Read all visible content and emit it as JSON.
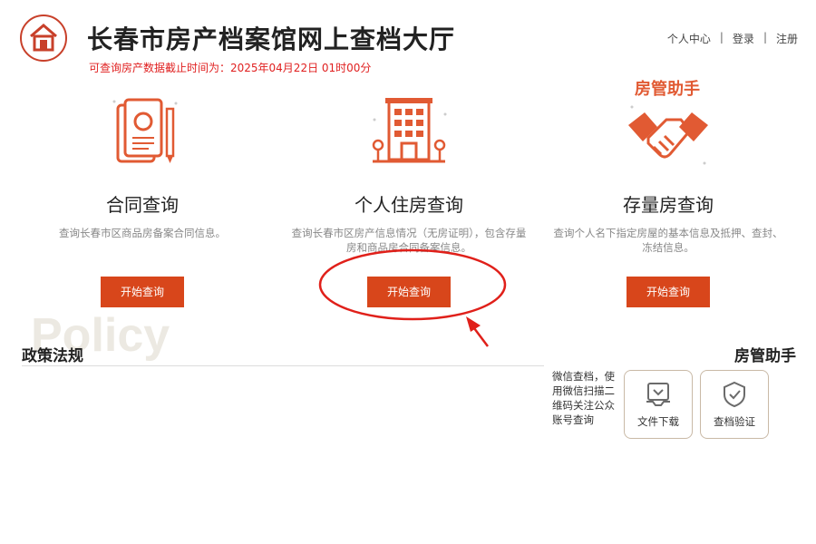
{
  "header": {
    "site_title": "长春市房产档案馆网上查档大厅",
    "notice": "可查询房产数据截止时间为：2025年04月22日 01时00分",
    "nav": {
      "personal_center": "个人中心",
      "login": "登录",
      "register": "注册",
      "separator": "|"
    }
  },
  "services": [
    {
      "title": "合同查询",
      "desc": "查询长春市区商品房备案合同信息。",
      "button": "开始查询",
      "icon": "contract-document-icon"
    },
    {
      "title": "个人住房查询",
      "desc": "查询长春市区房产信息情况（无房证明），包含存量房和商品房合同备案信息。",
      "button": "开始查询",
      "icon": "building-icon"
    },
    {
      "title": "存量房查询",
      "desc": "查询个人名下指定房屋的基本信息及抵押、查封、冻结信息。",
      "button": "开始查询",
      "icon": "handshake-icon",
      "tag": "房管助手"
    }
  ],
  "policy": {
    "watermark": "Policy",
    "title": "政策法规"
  },
  "helper": {
    "title": "房管助手",
    "desc": "微信查档，使用微信扫描二维码关注公众账号查询",
    "cards": [
      {
        "label": "文件下载",
        "icon": "file-download-icon"
      },
      {
        "label": "查档验证",
        "icon": "shield-check-icon"
      }
    ]
  },
  "colors": {
    "accent": "#d8461b",
    "icon_red": "#e15a33",
    "notice": "#e02020",
    "annotation": "#e0201a"
  }
}
